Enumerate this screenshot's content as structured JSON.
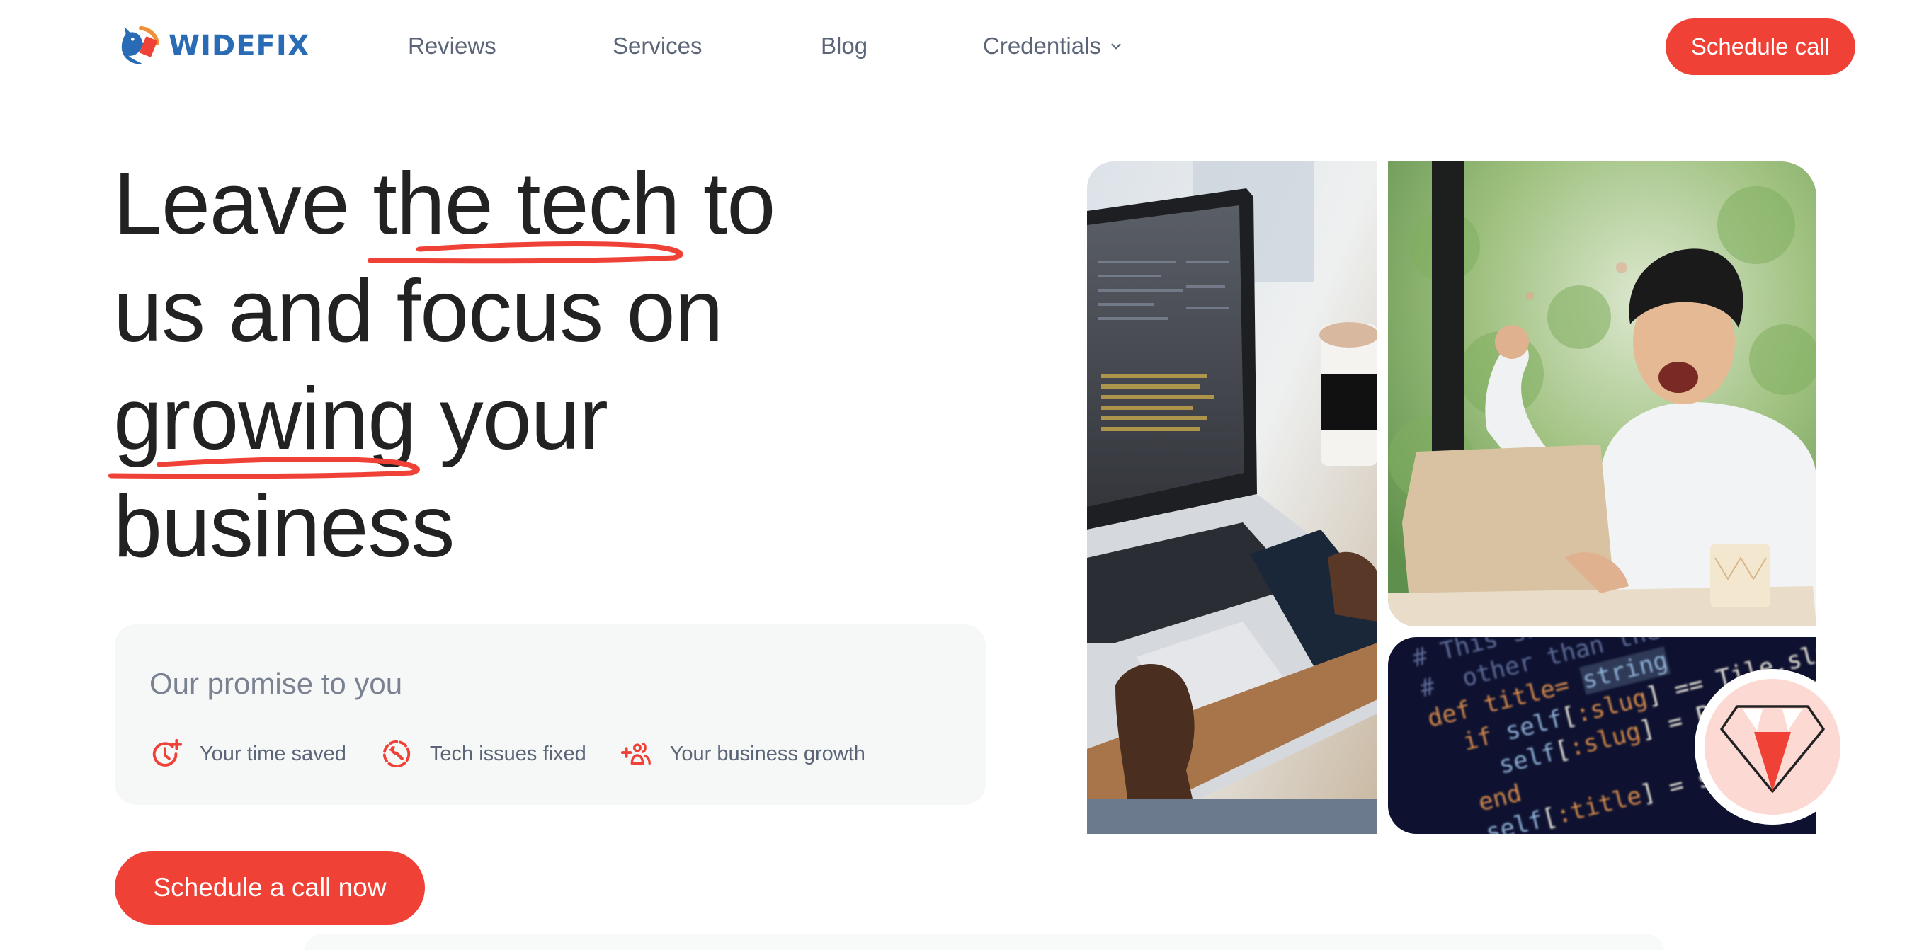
{
  "brand": {
    "name": "WIDEFIX",
    "colors": {
      "primary_blue": "#2A6BB5",
      "accent_red": "#EF4136",
      "accent_orange": "#F0913A"
    }
  },
  "nav": {
    "items": [
      {
        "label": "Reviews",
        "has_dropdown": false
      },
      {
        "label": "Services",
        "has_dropdown": false
      },
      {
        "label": "Blog",
        "has_dropdown": false
      },
      {
        "label": "Credentials",
        "has_dropdown": true
      }
    ],
    "cta_label": "Schedule call"
  },
  "hero": {
    "headline_lines": [
      {
        "parts": [
          {
            "text": "Leave ",
            "highlight": false
          },
          {
            "text": "the tech",
            "highlight": true
          },
          {
            "text": " to",
            "highlight": false
          }
        ]
      },
      {
        "parts": [
          {
            "text": "us and focus on",
            "highlight": false
          }
        ]
      },
      {
        "parts": [
          {
            "text": "growing",
            "highlight": true
          },
          {
            "text": " your",
            "highlight": false
          }
        ]
      },
      {
        "parts": [
          {
            "text": "business",
            "highlight": false
          }
        ]
      }
    ],
    "promise": {
      "title": "Our promise to you",
      "items": [
        {
          "icon": "clock-plus-icon",
          "label": "Your time saved"
        },
        {
          "icon": "wrench-circle-icon",
          "label": "Tech issues fixed"
        },
        {
          "icon": "user-group-plus-icon",
          "label": "Your business growth"
        }
      ]
    },
    "cta_label": "Schedule a call now"
  },
  "collage": {
    "images": [
      {
        "name": "laptop-coding-photo",
        "description": "Hands typing on a laptop showing code, phone and coffee cup on desk"
      },
      {
        "name": "excited-man-photo",
        "description": "Excited man cheering in front of a laptop"
      },
      {
        "name": "code-screen-photo",
        "description": "Dark editor screen with Ruby code"
      }
    ],
    "code_lines": [
      {
        "tokens": [
          {
            "t": "# This should be",
            "c": "c"
          }
        ]
      },
      {
        "tokens": [
          {
            "t": "#  other than the",
            "c": "c"
          }
        ]
      },
      {
        "tokens": [
          {
            "t": "def ",
            "c": "k"
          },
          {
            "t": "title= ",
            "c": "k"
          },
          {
            "t": "string",
            "c": "hi"
          }
        ]
      },
      {
        "tokens": [
          {
            "t": "  if ",
            "c": "k"
          },
          {
            "t": "self",
            "c": "v"
          },
          {
            "t": "[",
            "c": "w"
          },
          {
            "t": ":slug",
            "c": "k"
          },
          {
            "t": "] == Tile.slugize(",
            "c": "w"
          }
        ]
      },
      {
        "tokens": [
          {
            "t": "    self",
            "c": "v"
          },
          {
            "t": "[",
            "c": "w"
          },
          {
            "t": ":slug",
            "c": "k"
          },
          {
            "t": "] = Page.slugize(",
            "c": "w"
          }
        ]
      },
      {
        "tokens": [
          {
            "t": "  end",
            "c": "k"
          }
        ]
      },
      {
        "tokens": [
          {
            "t": "  self",
            "c": "v"
          },
          {
            "t": "[",
            "c": "w"
          },
          {
            "t": ":title",
            "c": "k"
          },
          {
            "t": "] = string",
            "c": "w"
          }
        ]
      }
    ],
    "badge_icon": "ruby-gem-icon"
  }
}
